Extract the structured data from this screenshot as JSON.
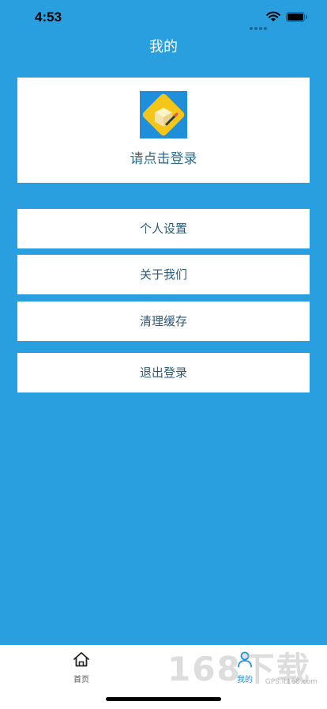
{
  "status_bar": {
    "time": "4:53",
    "icons": [
      "signal-dots-icon",
      "wifi-icon",
      "battery-icon"
    ]
  },
  "header": {
    "title": "我的"
  },
  "profile": {
    "avatar_icon": "package-edit-icon",
    "login_prompt": "请点击登录"
  },
  "menu": {
    "items": [
      {
        "label": "个人设置"
      },
      {
        "label": "关于我们"
      },
      {
        "label": "清理缓存"
      },
      {
        "label": "退出登录"
      }
    ]
  },
  "tab_bar": {
    "tabs": [
      {
        "label": "首页",
        "icon": "home-icon",
        "active": false
      },
      {
        "label": "我的",
        "icon": "user-icon",
        "active": true
      }
    ]
  },
  "watermark": {
    "brand": "168下载",
    "url": "GPS.it168.com"
  },
  "colors": {
    "background": "#2a9fe0",
    "card": "#ffffff",
    "text_primary": "#2e5a78",
    "tab_active": "#1f8fdb",
    "avatar_bg": "#1f8fdb",
    "avatar_badge": "#f5c518"
  }
}
